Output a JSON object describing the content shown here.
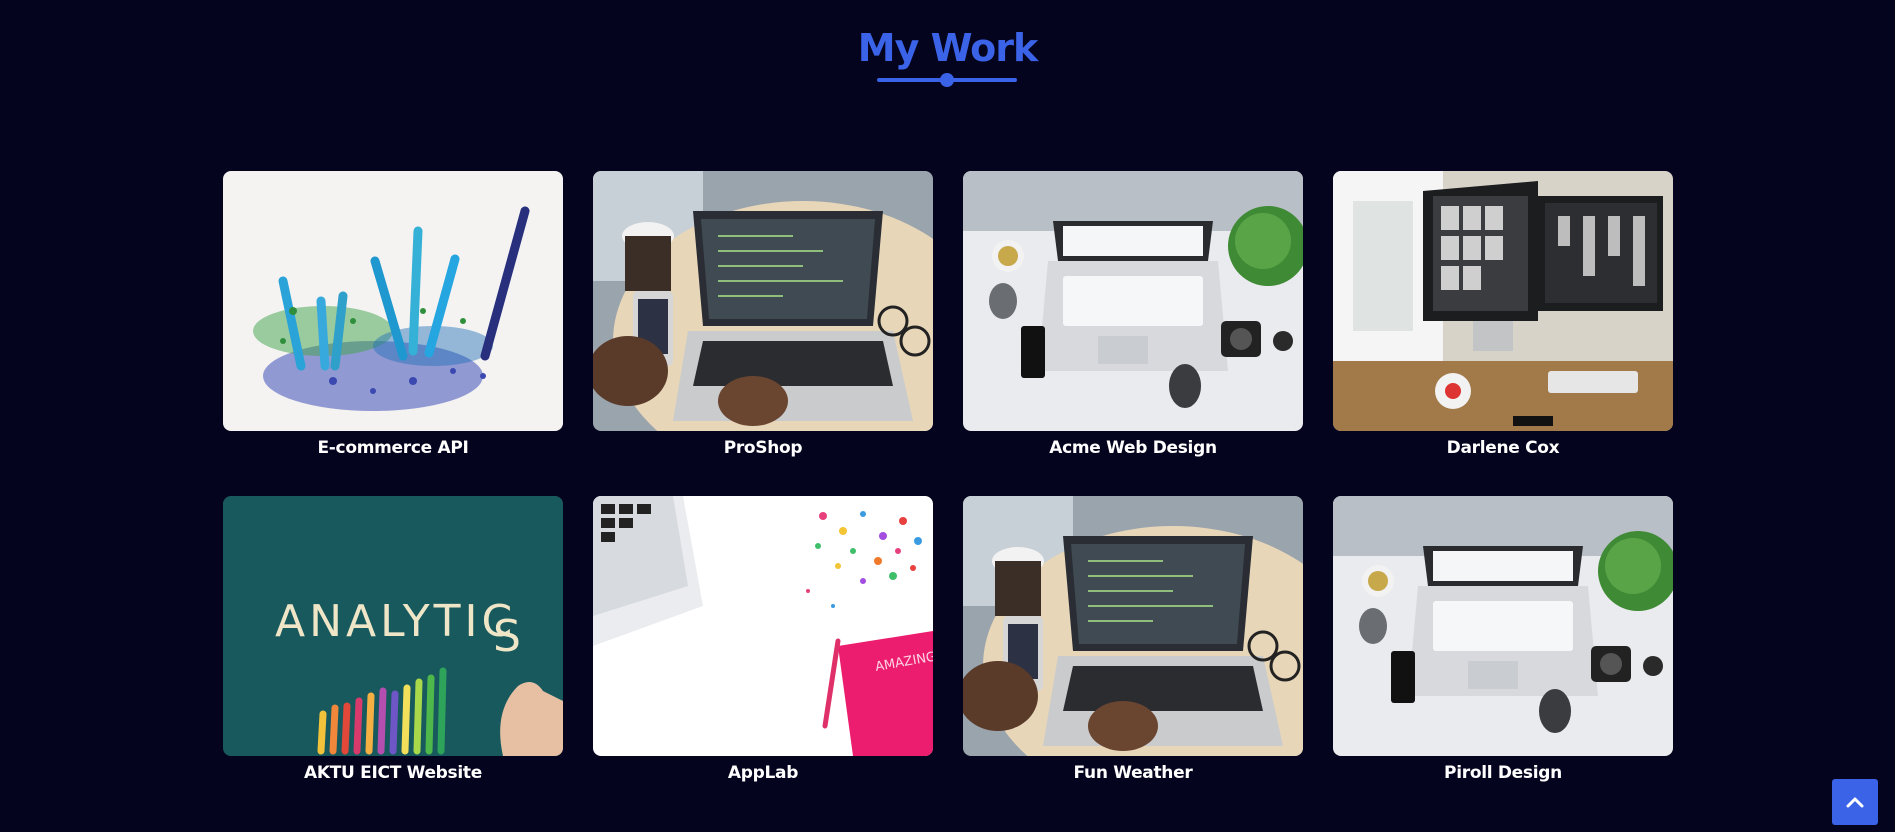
{
  "section": {
    "title": "My Work"
  },
  "projects": [
    {
      "label": "E-commerce API",
      "image": "pencils-shavings"
    },
    {
      "label": "ProShop",
      "image": "laptop-coffee-table"
    },
    {
      "label": "Acme Web Design",
      "image": "white-desk-laptop"
    },
    {
      "label": "Darlene Cox",
      "image": "imac-office"
    },
    {
      "label": "AKTU EICT Website",
      "image": "analytics-letters"
    },
    {
      "label": "AppLab",
      "image": "laptop-confetti-notebook"
    },
    {
      "label": "Fun Weather",
      "image": "laptop-coffee-table"
    },
    {
      "label": "Piroll Design",
      "image": "white-desk-laptop"
    }
  ],
  "back_to_top": {
    "icon": "chevron-up-icon"
  },
  "colors": {
    "background": "#05041e",
    "accent": "#3a63e8",
    "label": "#ffffff"
  }
}
